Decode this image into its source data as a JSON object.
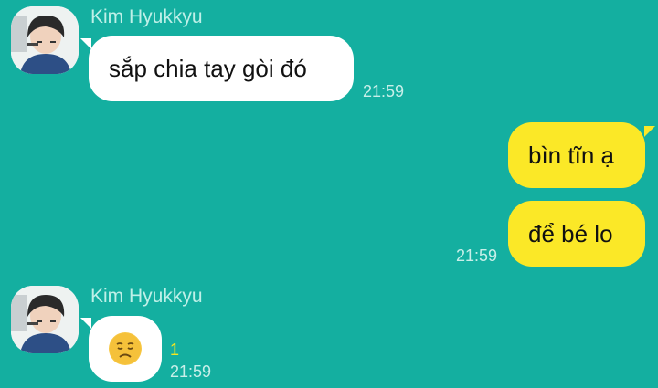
{
  "messages": [
    {
      "sender": "Kim Hyukkyu",
      "text": "sắp chia tay gòi đó",
      "time": "21:59"
    },
    {
      "text": "bìn tĩn ạ"
    },
    {
      "text": "để bé lo",
      "time": "21:59"
    },
    {
      "sender": "Kim Hyukkyu",
      "emoji": "disappointed-face",
      "unread": "1",
      "time": "21:59"
    }
  ],
  "colors": {
    "background": "#14afa0",
    "incoming": "#ffffff",
    "outgoing": "#fbe827"
  }
}
